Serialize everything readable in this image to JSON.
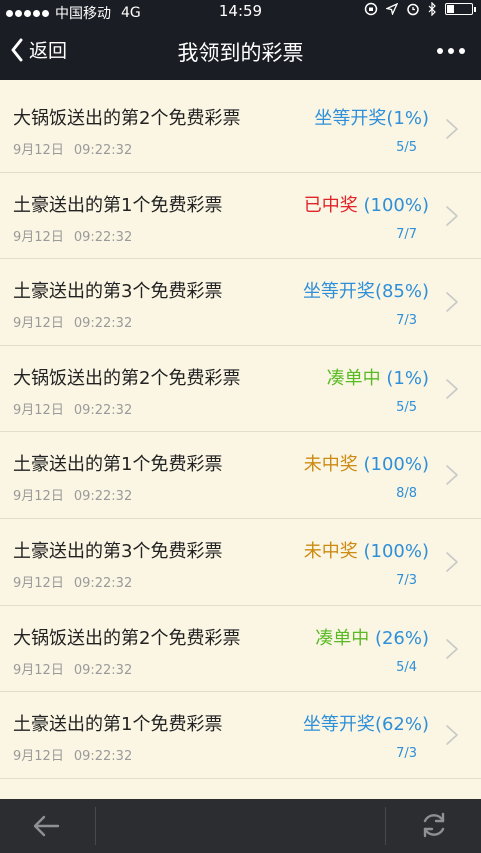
{
  "status_bar": {
    "carrier": "中国移动",
    "network": "4G",
    "time": "14:59"
  },
  "nav": {
    "back_label": "返回",
    "title": "我领到的彩票"
  },
  "colors": {
    "won": "#e0242a",
    "waiting": "#2f8fd8",
    "gathering": "#5aba25",
    "not_won": "#cc8b12",
    "percent": "#2f8fd8"
  },
  "tickets": [
    {
      "name": "大锅饭送出的第2个免费彩票",
      "date": "9月12日",
      "time": "09:22:32",
      "status": "坐等开奖",
      "status_type": "waiting",
      "percent": "(1%)",
      "count": "5/5"
    },
    {
      "name": "土豪送出的第1个免费彩票",
      "date": "9月12日",
      "time": "09:22:32",
      "status": "已中奖",
      "status_type": "won",
      "percent": " (100%)",
      "count": "7/7"
    },
    {
      "name": "土豪送出的第3个免费彩票",
      "date": "9月12日",
      "time": "09:22:32",
      "status": "坐等开奖",
      "status_type": "waiting",
      "percent": "(85%)",
      "count": "7/3"
    },
    {
      "name": "大锅饭送出的第2个免费彩票",
      "date": "9月12日",
      "time": "09:22:32",
      "status": "凑单中",
      "status_type": "gathering",
      "percent": " (1%)",
      "count": "5/5"
    },
    {
      "name": "土豪送出的第1个免费彩票",
      "date": "9月12日",
      "time": "09:22:32",
      "status": "未中奖",
      "status_type": "not_won",
      "percent": " (100%)",
      "count": "8/8"
    },
    {
      "name": "土豪送出的第3个免费彩票",
      "date": "9月12日",
      "time": "09:22:32",
      "status": "未中奖",
      "status_type": "not_won",
      "percent": " (100%)",
      "count": "7/3"
    },
    {
      "name": "大锅饭送出的第2个免费彩票",
      "date": "9月12日",
      "time": "09:22:32",
      "status": "凑单中",
      "status_type": "gathering",
      "percent": " (26%)",
      "count": "5/4"
    },
    {
      "name": "土豪送出的第1个免费彩票",
      "date": "9月12日",
      "time": "09:22:32",
      "status": "坐等开奖",
      "status_type": "waiting",
      "percent": "(62%)",
      "count": "7/3"
    }
  ],
  "icons": {
    "back": "chevron-left-icon",
    "more": "more-dots-icon",
    "row_arrow": "chevron-right-icon",
    "toolbar_back": "arrow-left-icon",
    "toolbar_refresh": "refresh-icon"
  }
}
